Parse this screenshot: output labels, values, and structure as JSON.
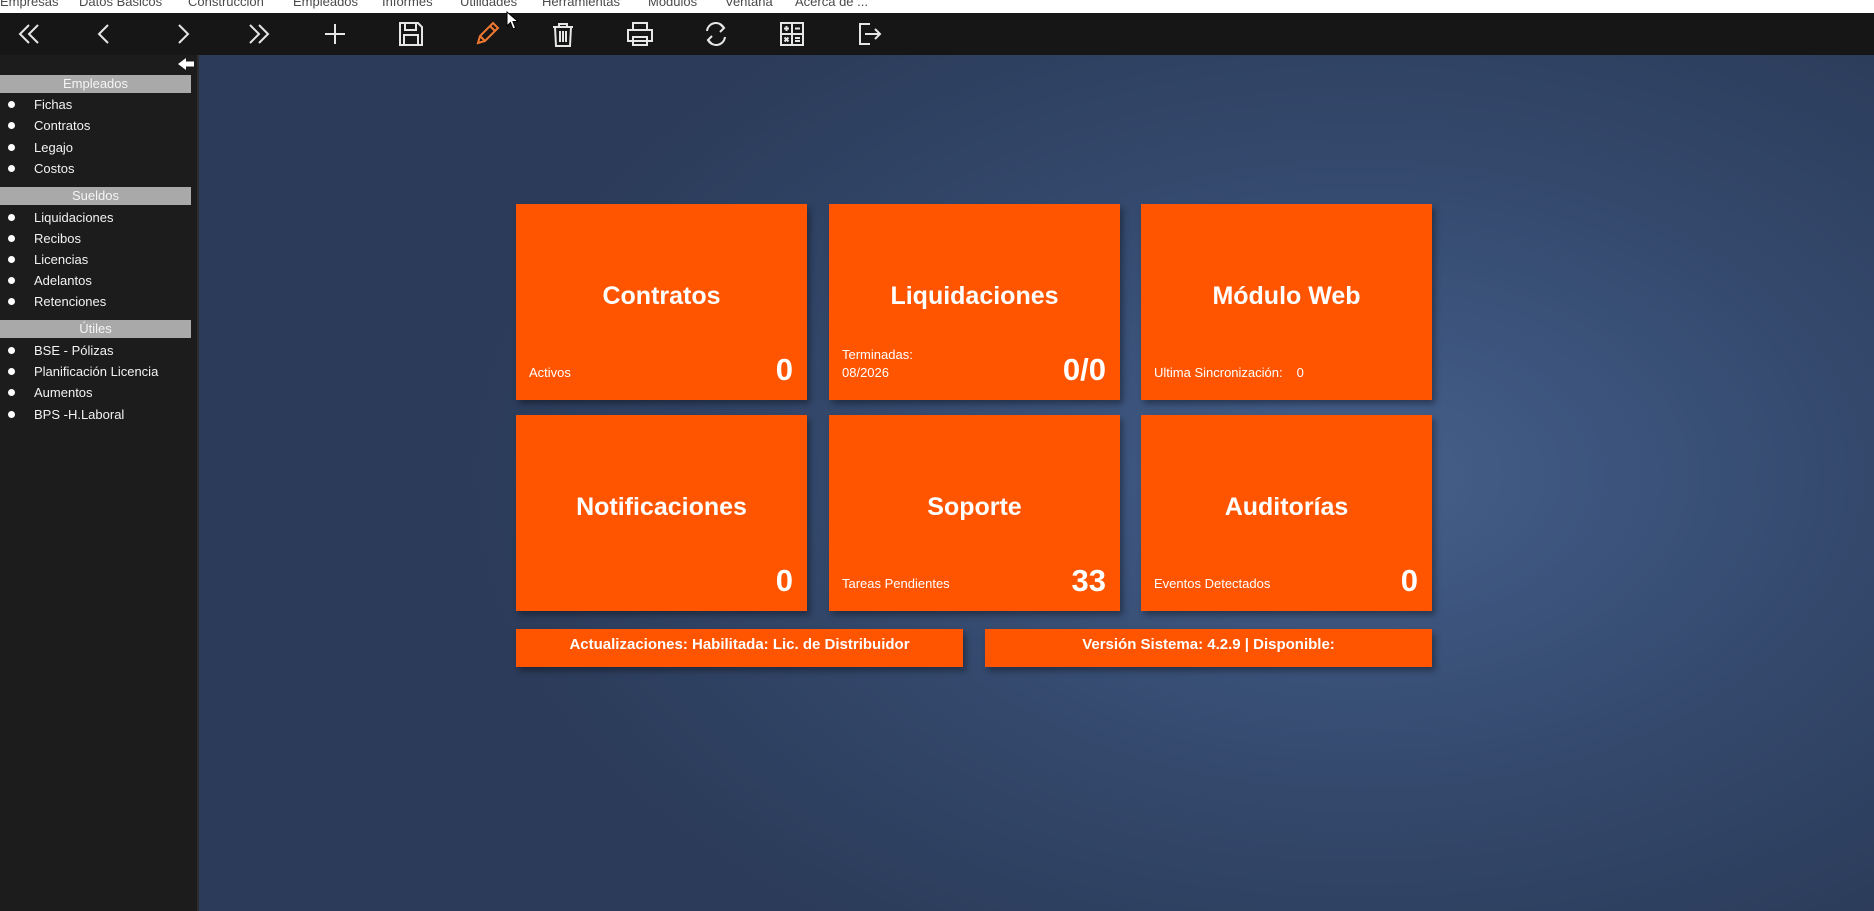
{
  "menubar": {
    "items": [
      "Empresas",
      "Datos Básicos",
      "Construcción",
      "Empleados",
      "Informes",
      "Utilidades",
      "Herramientas",
      "Módulos",
      "Ventana",
      "Acerca de ..."
    ]
  },
  "toolbar": {
    "buttons": [
      {
        "name": "first-record",
        "icon": "double-chevron-left-icon"
      },
      {
        "name": "previous-record",
        "icon": "chevron-left-icon"
      },
      {
        "name": "next-record",
        "icon": "chevron-right-icon"
      },
      {
        "name": "last-record",
        "icon": "double-chevron-right-icon"
      },
      {
        "name": "add",
        "icon": "plus-icon"
      },
      {
        "name": "save",
        "icon": "floppy-disk-icon"
      },
      {
        "name": "edit",
        "icon": "pencil-icon",
        "color": "#f07830"
      },
      {
        "name": "delete",
        "icon": "trash-icon"
      },
      {
        "name": "print",
        "icon": "printer-icon"
      },
      {
        "name": "refresh",
        "icon": "refresh-icon"
      },
      {
        "name": "calculator",
        "icon": "calculator-icon"
      },
      {
        "name": "exit",
        "icon": "exit-icon"
      }
    ]
  },
  "sidebar": {
    "collapse_icon": "arrow-left-icon",
    "sections": [
      {
        "title": "Empleados",
        "items": [
          "Fichas",
          "Contratos",
          "Legajo",
          "Costos"
        ]
      },
      {
        "title": "Sueldos",
        "items": [
          "Liquidaciones",
          "Recibos",
          "Licencias",
          "Adelantos",
          "Retenciones"
        ]
      },
      {
        "title": "Útiles",
        "items": [
          "BSE - Pólizas",
          "Planificación Licencia",
          "Aumentos",
          "BPS -H.Laboral"
        ]
      }
    ]
  },
  "dashboard": {
    "tiles": {
      "contratos": {
        "title": "Contratos",
        "subtitle": "Activos",
        "value": "0"
      },
      "liquidaciones": {
        "title": "Liquidaciones",
        "subtitle_line1": "Terminadas:",
        "subtitle_line2": "08/2026",
        "value": "0/0"
      },
      "modulo_web": {
        "title": "Módulo Web",
        "subtitle": "Ultima Sincronización:",
        "sync_value": "0"
      },
      "notificaciones": {
        "title": "Notificaciones",
        "value": "0"
      },
      "soporte": {
        "title": "Soporte",
        "subtitle": "Tareas Pendientes",
        "value": "33"
      },
      "auditorias": {
        "title": "Auditorías",
        "subtitle": "Eventos Detectados",
        "value": "0"
      }
    },
    "updates_bar": "Actualizaciones: Habilitada: Lic. de Distribuidor",
    "version_bar": "Versión Sistema: 4.2.9 | Disponible:"
  },
  "colors": {
    "accent": "#ff5500",
    "edit_icon": "#f07830",
    "sidebar_bg": "#1c1c1c",
    "section_header": "#a9a9a9"
  }
}
